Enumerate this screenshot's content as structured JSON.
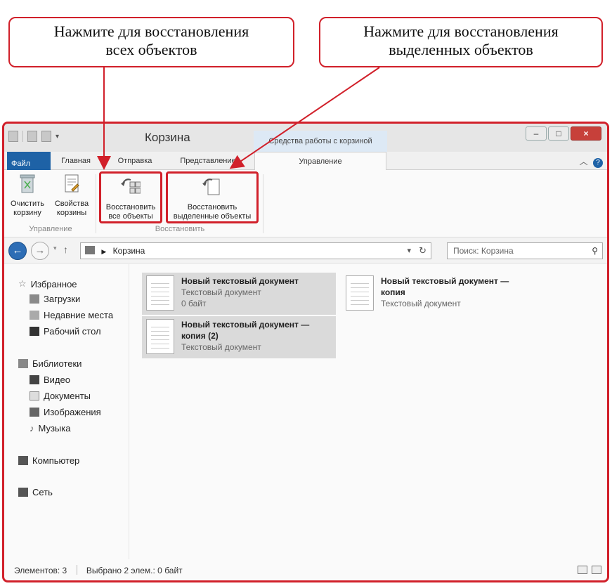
{
  "callouts": {
    "left_line1": "Нажмите для восстановления",
    "left_line2": "всех объектов",
    "right_line1": "Нажмите для восстановления",
    "right_line2": "выделенных объектов"
  },
  "window": {
    "title": "Корзина",
    "tools_tab": "Средства работы с корзиной"
  },
  "tabs": {
    "file": "Файл",
    "home": "Главная",
    "share": "Отправка",
    "view": "Представление",
    "manage": "Управление"
  },
  "ribbon": {
    "empty_line1": "Очистить",
    "empty_line2": "корзину",
    "props_line1": "Свойства",
    "props_line2": "корзины",
    "restore_all_line1": "Восстановить",
    "restore_all_line2": "все объекты",
    "restore_sel_line1": "Восстановить",
    "restore_sel_line2": "выделенные объекты",
    "group_manage": "Управление",
    "group_restore": "Восстановить"
  },
  "address": {
    "path": "Корзина",
    "search_placeholder": "Поиск: Корзина"
  },
  "nav": {
    "favorites": "Избранное",
    "downloads": "Загрузки",
    "recent": "Недавние места",
    "desktop": "Рабочий стол",
    "libraries": "Библиотеки",
    "video": "Видео",
    "documents": "Документы",
    "images": "Изображения",
    "music": "Музыка",
    "computer": "Компьютер",
    "network": "Сеть"
  },
  "files": [
    {
      "name": "Новый текстовый документ",
      "type": "Текстовый документ",
      "size": "0 байт"
    },
    {
      "name": "Новый текстовый документ —\nкопия",
      "type": "Текстовый документ",
      "size": ""
    },
    {
      "name": "Новый текстовый документ —\nкопия (2)",
      "type": "Текстовый документ",
      "size": ""
    }
  ],
  "status": {
    "count": "Элементов: 3",
    "selected": "Выбрано 2 элем.: 0 байт"
  },
  "colors": {
    "highlight": "#d1202a",
    "file_tab": "#1e62a6"
  }
}
